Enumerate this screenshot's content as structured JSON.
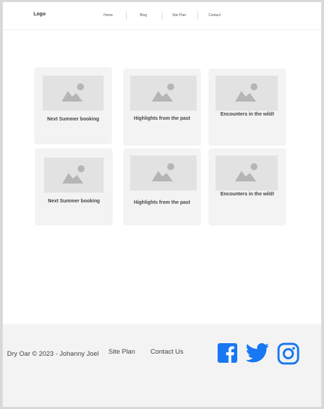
{
  "header": {
    "logo": "Logo",
    "nav": [
      "Home",
      "Blog",
      "Site Plan",
      "Contact"
    ]
  },
  "cards": [
    {
      "title": "Next Summer booking",
      "image_icon": "image-placeholder-icon"
    },
    {
      "title": "Highlights from the past",
      "image_icon": "image-placeholder-icon"
    },
    {
      "title": "Encounters in the wild!",
      "image_icon": "image-placeholder-icon"
    },
    {
      "title": "Next Summer booking",
      "image_icon": "image-placeholder-icon"
    },
    {
      "title": "Highlights from the past",
      "image_icon": "image-placeholder-icon"
    },
    {
      "title": "Encounters in the wild!",
      "image_icon": "image-placeholder-icon"
    }
  ],
  "footer": {
    "copyright": "Dry Oar © 2023 - Johanny Joel",
    "links": [
      "Site Plan",
      "Contact Us"
    ],
    "social": [
      "facebook-icon",
      "twitter-icon",
      "instagram-icon"
    ]
  },
  "colors": {
    "social_blue": "#1877f2",
    "card_bg": "#f3f3f3",
    "placeholder_bg": "#e2e2e2",
    "placeholder_icon": "#b5b5b5"
  }
}
